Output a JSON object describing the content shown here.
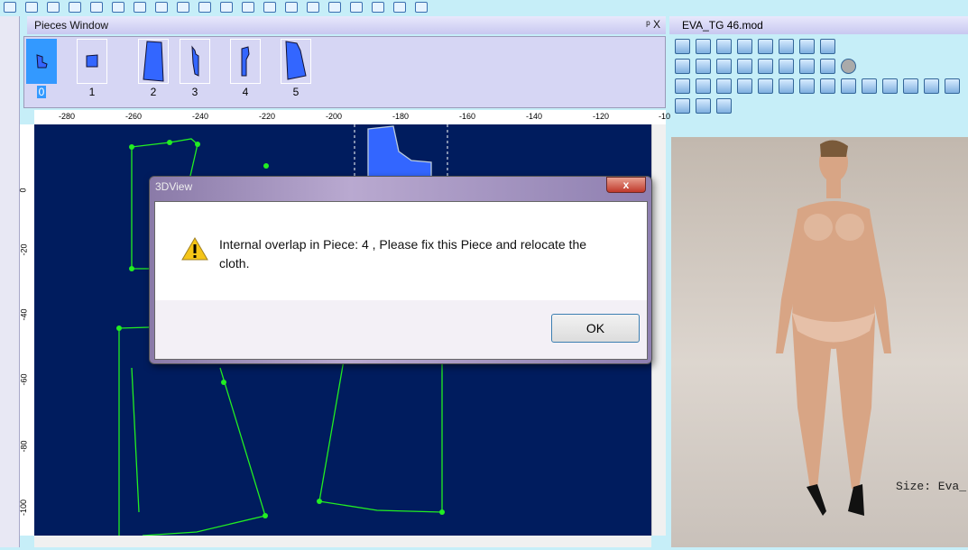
{
  "pieces_window": {
    "title": "Pieces Window",
    "controls": "ᵖ X",
    "pieces": [
      {
        "label": "0",
        "selected": true
      },
      {
        "label": "1"
      },
      {
        "label": "2"
      },
      {
        "label": "3"
      },
      {
        "label": "4"
      },
      {
        "label": "5"
      }
    ]
  },
  "ruler": {
    "top": [
      "-280",
      "-260",
      "-240",
      "-220",
      "-200",
      "-180",
      "-160",
      "-140",
      "-120",
      "-10"
    ],
    "left": [
      "0",
      "-20",
      "-40",
      "-60",
      "-80",
      "-100"
    ]
  },
  "right_panel": {
    "title": "EVA_TG 46.mod",
    "size_label": "Size: Eva_"
  },
  "dialog": {
    "title": "3DView",
    "close": "x",
    "message": " Internal overlap in Piece: 4 , Please fix this Piece and relocate the cloth.",
    "ok": "OK"
  },
  "colors": {
    "canvas": "#001c5e",
    "pattern": "#22ee22",
    "piece_fill": "#3366ff"
  }
}
